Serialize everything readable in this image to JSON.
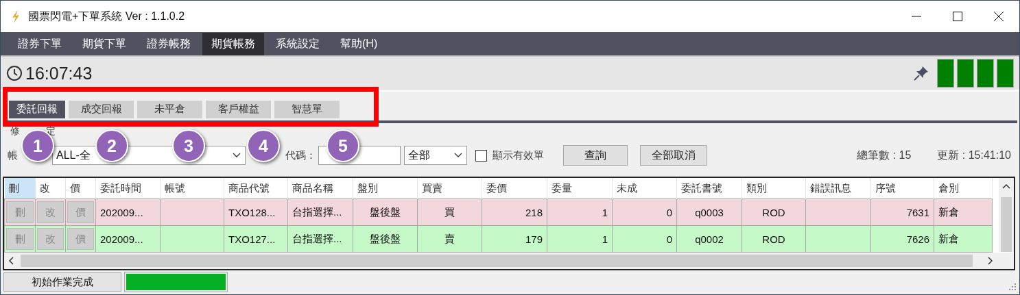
{
  "window": {
    "title": "國票閃電+下單系統 Ver : 1.1.0.2"
  },
  "menu": [
    {
      "label": "證券下單",
      "selected": false
    },
    {
      "label": "期貨下單",
      "selected": false
    },
    {
      "label": "證券帳務",
      "selected": false
    },
    {
      "label": "期貨帳務",
      "selected": true
    },
    {
      "label": "系統設定",
      "selected": false
    },
    {
      "label": "幫助(H)",
      "selected": false
    }
  ],
  "clock": "16:07:43",
  "status_lights": [
    {
      "color": "#008000"
    },
    {
      "color": "#008000"
    },
    {
      "color": "#008000"
    },
    {
      "color": "#008000"
    }
  ],
  "tabs": [
    {
      "label": "委託回報",
      "selected": true
    },
    {
      "label": "成交回報",
      "selected": false
    },
    {
      "label": "未平倉",
      "selected": false
    },
    {
      "label": "客戶權益",
      "selected": false
    },
    {
      "label": "智慧單",
      "selected": false
    }
  ],
  "filter": {
    "group_label_parts": [
      "修",
      "定"
    ],
    "account_label": "帳",
    "account_value": "ALL-全",
    "product_label": "代碼：",
    "type_value": "全部",
    "valid_only": {
      "label": "顯示有效單",
      "checked": false
    },
    "buttons": [
      "查詢",
      "全部取消"
    ],
    "total": "總筆數 : 15",
    "updated": "更新 : 15:41:10"
  },
  "table": {
    "columns": [
      {
        "label": "刪",
        "selected": true
      },
      {
        "label": "改",
        "selected": false
      },
      {
        "label": "價",
        "selected": false
      },
      {
        "label": "委託時間",
        "selected": false
      },
      {
        "label": "帳號",
        "selected": false
      },
      {
        "label": "商品代號",
        "selected": false
      },
      {
        "label": "商品名稱",
        "selected": false
      },
      {
        "label": "盤別",
        "selected": false
      },
      {
        "label": "買賣",
        "selected": false
      },
      {
        "label": "委價",
        "selected": false
      },
      {
        "label": "委量",
        "selected": false
      },
      {
        "label": "未成",
        "selected": false
      },
      {
        "label": "委託書號",
        "selected": false
      },
      {
        "label": "類別",
        "selected": false
      },
      {
        "label": "錯誤訊息",
        "selected": false
      },
      {
        "label": "序號",
        "selected": false
      },
      {
        "label": "倉別",
        "selected": false
      }
    ],
    "rows": [
      {
        "color": "#f2d7dc",
        "cells": [
          "刪",
          "改",
          "價",
          "202009...",
          "",
          "TXO128...",
          "台指選擇...",
          "盤後盤",
          "買",
          "218",
          "1",
          "0",
          "q0003",
          "ROD",
          "",
          "7631",
          "新倉"
        ]
      },
      {
        "color": "#c5f9c8",
        "cells": [
          "刪",
          "改",
          "價",
          "202009...",
          "",
          "TXO127...",
          "台指選擇...",
          "盤後盤",
          "賣",
          "179",
          "1",
          "0",
          "q0002",
          "ROD",
          "",
          "7626",
          "新倉"
        ]
      }
    ]
  },
  "status_bar": {
    "message": "初始作業完成",
    "progress": {
      "level": 1
    }
  },
  "annotations": {
    "highlight": true,
    "callouts": [
      "1",
      "2",
      "3",
      "4",
      "5"
    ]
  }
}
